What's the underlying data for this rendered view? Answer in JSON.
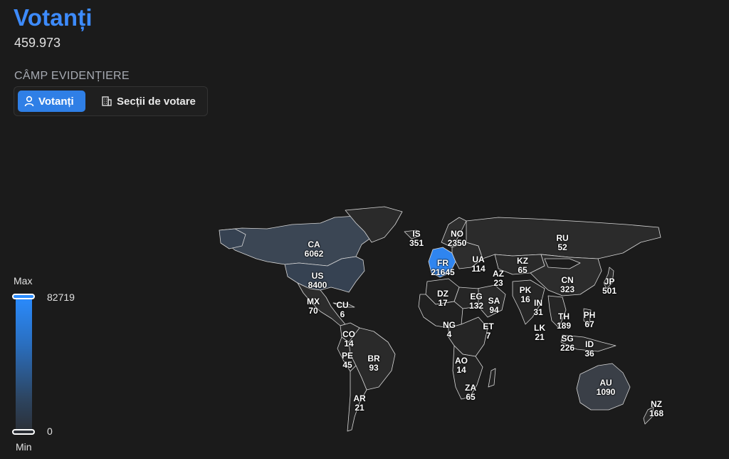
{
  "header": {
    "title": "Votanți",
    "total": "459.973",
    "field_label": "CÂMP EVIDENȚIERE"
  },
  "toggle": {
    "options": [
      {
        "label": "Votanți",
        "icon": "person-icon",
        "selected": true
      },
      {
        "label": "Secții de votare",
        "icon": "building-icon",
        "selected": false
      }
    ]
  },
  "legend": {
    "max_label": "Max",
    "min_label": "Min",
    "max_value": "82719",
    "min_value": "0",
    "color_high": "#2a8cff",
    "color_low": "#2b2f36"
  },
  "countries": [
    {
      "code": "CA",
      "value": "6062"
    },
    {
      "code": "US",
      "value": "8400"
    },
    {
      "code": "MX",
      "value": "70"
    },
    {
      "code": "CU",
      "value": "6"
    },
    {
      "code": "CO",
      "value": "14"
    },
    {
      "code": "PE",
      "value": "45"
    },
    {
      "code": "BR",
      "value": "93"
    },
    {
      "code": "AR",
      "value": "21"
    },
    {
      "code": "IS",
      "value": "351"
    },
    {
      "code": "NO",
      "value": "2350"
    },
    {
      "code": "FR",
      "value": "21645"
    },
    {
      "code": "UA",
      "value": "114"
    },
    {
      "code": "RU",
      "value": "52"
    },
    {
      "code": "KZ",
      "value": "65"
    },
    {
      "code": "AZ",
      "value": "23"
    },
    {
      "code": "CN",
      "value": "323"
    },
    {
      "code": "JP",
      "value": "501"
    },
    {
      "code": "DZ",
      "value": "17"
    },
    {
      "code": "EG",
      "value": "132"
    },
    {
      "code": "SA",
      "value": "94"
    },
    {
      "code": "PK",
      "value": "16"
    },
    {
      "code": "IN",
      "value": "31"
    },
    {
      "code": "TH",
      "value": "189"
    },
    {
      "code": "PH",
      "value": "67"
    },
    {
      "code": "LK",
      "value": "21"
    },
    {
      "code": "SG",
      "value": "226"
    },
    {
      "code": "ID",
      "value": "36"
    },
    {
      "code": "NG",
      "value": "4"
    },
    {
      "code": "ET",
      "value": "7"
    },
    {
      "code": "AO",
      "value": "14"
    },
    {
      "code": "ZA",
      "value": "65"
    },
    {
      "code": "AU",
      "value": "1090"
    },
    {
      "code": "NZ",
      "value": "168"
    }
  ]
}
